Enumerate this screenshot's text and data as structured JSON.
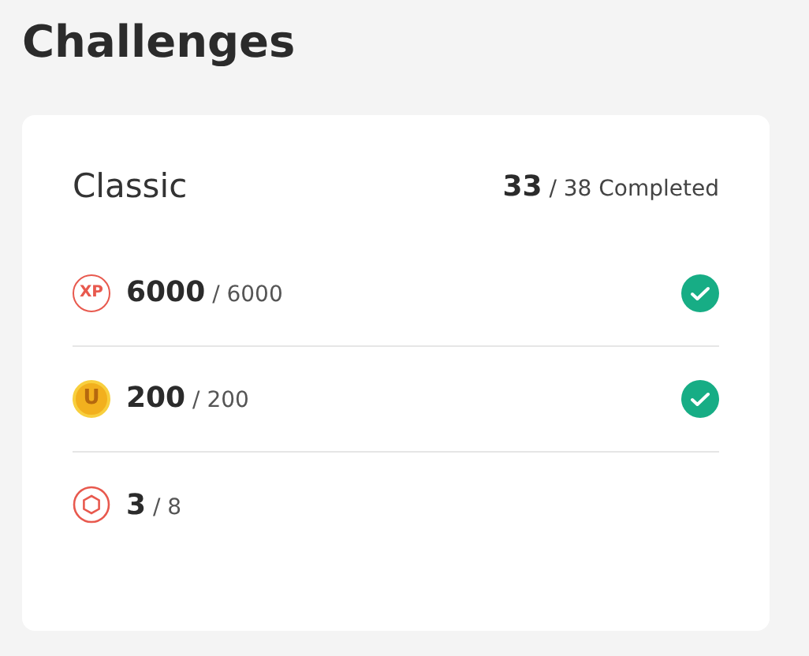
{
  "title": "Challenges",
  "card": {
    "name": "Classic",
    "completed": "33",
    "total": "/ 38 Completed"
  },
  "rows": [
    {
      "kind": "xp",
      "icon_text": "XP",
      "value": "6000",
      "total": "/ 6000",
      "done": true
    },
    {
      "kind": "coin",
      "icon_text": "U",
      "value": "200",
      "total": "/ 200",
      "done": true
    },
    {
      "kind": "hex",
      "value": "3",
      "total": "/ 8",
      "done": false
    }
  ]
}
